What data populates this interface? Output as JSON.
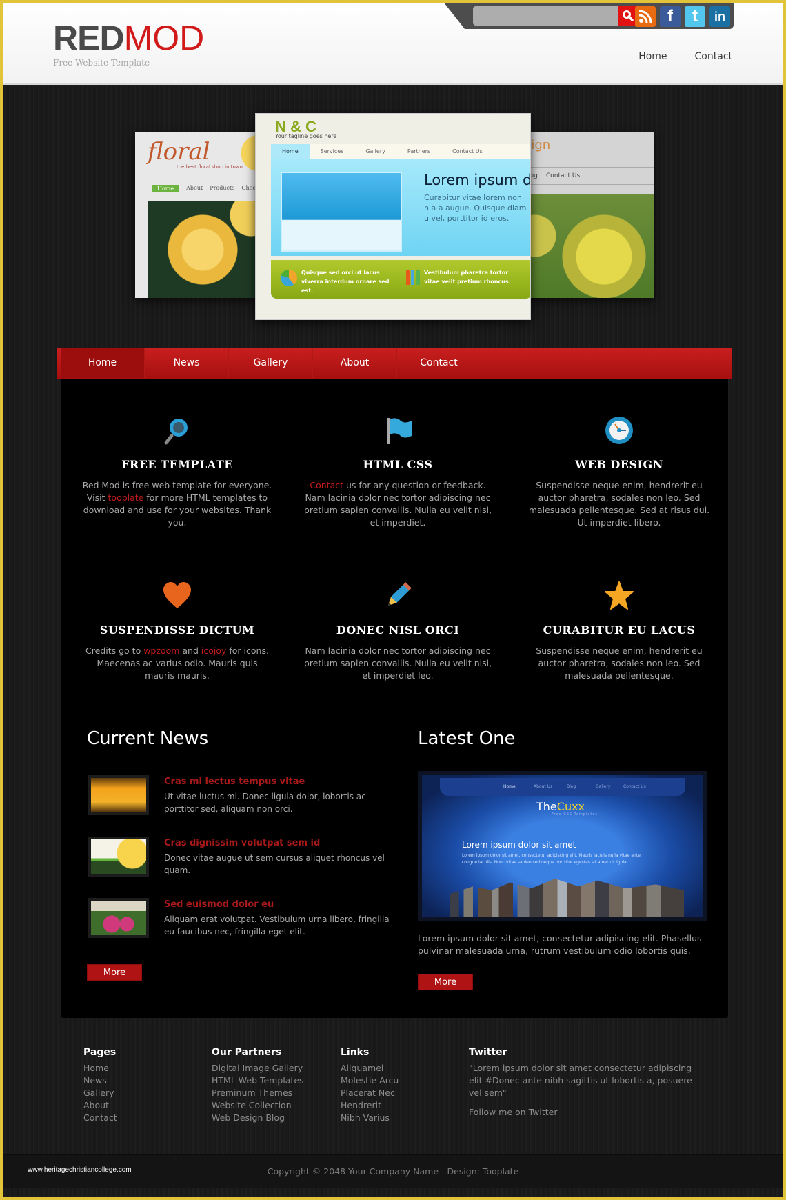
{
  "header": {
    "logo_primary": "RED",
    "logo_secondary": "MOD",
    "tagline": "Free Website Template",
    "search_placeholder": "",
    "social": [
      "rss-icon",
      "facebook-icon",
      "twitter-icon",
      "linkedin-icon"
    ],
    "top_links": [
      "Home",
      "Contact"
    ]
  },
  "slider": {
    "left": {
      "title": "floral",
      "subtitle": "the best floral shop in town",
      "nav": [
        "Home",
        "About",
        "Products",
        "Checkout"
      ]
    },
    "center": {
      "title": "N & C",
      "tagline": "Your tagline goes here",
      "nav": [
        "Home",
        "Services",
        "Gallery",
        "Partners",
        "Contact Us"
      ],
      "heading": "Lorem ipsum d",
      "text": "Curabitur vitae lorem non n a a augue. Quisque diam u vel, porttitor id eros.",
      "footer_left": "Quisque sed orci ut lacus viverra interdum ornare sed est.",
      "footer_right": "Vestibulum pharetra tortor vitae velit pretium rhoncus."
    },
    "right": {
      "title": "Design",
      "nav": [
        "Blog",
        "Contact Us"
      ]
    }
  },
  "nav": {
    "items": [
      "Home",
      "News",
      "Gallery",
      "About",
      "Contact"
    ],
    "active": "Home"
  },
  "features": [
    {
      "icon": "search-icon",
      "title": "FREE TEMPLATE",
      "text_before": "Red Mod is free web template for everyone. Visit ",
      "link": "tooplate",
      "text_after": " for more HTML templates to download and use for your websites. Thank you."
    },
    {
      "icon": "flag-icon",
      "title": "HTML CSS",
      "text_before": "",
      "link": "Contact",
      "text_after": " us for any question or feedback. Nam lacinia dolor nec tortor adipiscing nec pretium sapien convallis. Nulla eu velit nisi, et imperdiet."
    },
    {
      "icon": "clock-icon",
      "title": "WEB DESIGN",
      "text_before": "Suspendisse neque enim, hendrerit eu auctor pharetra, sodales non leo. Sed malesuada pellentesque. Sed at risus dui. Ut imperdiet libero.",
      "link": "",
      "text_after": ""
    },
    {
      "icon": "heart-icon",
      "title": "SUSPENDISSE DICTUM",
      "text_before": "Credits go to ",
      "link": "wpzoom",
      "text_mid": " and ",
      "link2": "icojoy",
      "text_after": " for icons. Maecenas ac varius odio. Mauris quis mauris mauris."
    },
    {
      "icon": "pencil-icon",
      "title": "DONEC NISL ORCI",
      "text_before": "Nam lacinia dolor nec tortor adipiscing nec pretium sapien convallis. Nulla eu velit nisi, et imperdiet leo.",
      "link": "",
      "text_after": ""
    },
    {
      "icon": "star-icon",
      "title": "CURABITUR EU LACUS",
      "text_before": "Suspendisse neque enim, hendrerit eu auctor pharetra, sodales non leo. Sed malesuada pellentesque.",
      "link": "",
      "text_after": ""
    }
  ],
  "news": {
    "title": "Current News",
    "items": [
      {
        "headline": "Cras mi lectus tempus vitae",
        "text": "Ut vitae luctus mi. Donec ligula dolor, lobortis ac porttitor sed, aliquam non orci."
      },
      {
        "headline": "Cras dignissim volutpat sem id",
        "text": "Donec vitae augue ut sem cursus aliquet rhoncus vel quam."
      },
      {
        "headline": "Sed euismod dolor eu",
        "text": "Aliquam erat volutpat. Vestibulum urna libero, fringilla eu faucibus nec, fringilla eget elit."
      }
    ],
    "more_label": "More"
  },
  "latest": {
    "title": "Latest One",
    "preview": {
      "nav": [
        "Home",
        "About Us",
        "Blog",
        "Gallery",
        "Contact Us"
      ],
      "logo_a": "The",
      "logo_b": "Cuxx",
      "logo_sub": "Free CSS Templates",
      "heading": "Lorem ipsum dolor sit amet",
      "text": "Lorem ipsum dolor sit amet, consectetur adipiscing elit. Mauris iaculis nulla vitae ante congue iaculis. Nunc vitae sapien sed neque porttitor egestas sit amet ut ligula."
    },
    "text": "Lorem ipsum dolor sit amet, consectetur adipiscing elit. Phasellus pulvinar malesuada urna, rutrum vestibulum odio lobortis quis.",
    "more_label": "More"
  },
  "footer": {
    "pages": {
      "title": "Pages",
      "links": [
        "Home",
        "News",
        "Gallery",
        "About",
        "Contact"
      ]
    },
    "partners": {
      "title": "Our Partners",
      "links": [
        "Digital Image Gallery",
        "HTML Web Templates",
        "Preminum Themes",
        "Website Collection",
        "Web Design Blog"
      ]
    },
    "links": {
      "title": "Links",
      "links": [
        "Aliquamel",
        "Molestie Arcu",
        "Placerat Nec",
        "Hendrerit",
        "Nibh Varius"
      ]
    },
    "twitter": {
      "title": "Twitter",
      "tweet": "\"Lorem ipsum dolor sit amet consectetur adipiscing elit #Donec ante nibh sagittis ut lobortis a, posuere vel sem\"",
      "follow": "Follow me on Twitter"
    },
    "watermark": "www.heritagechristiancollege.com",
    "copyright": "Copyright © 2048 Your Company Name - Design: Tooplate"
  },
  "colors": {
    "accent_red": "#c41c1c",
    "nav_red": "#b81717",
    "page_border": "#e2c43a"
  }
}
